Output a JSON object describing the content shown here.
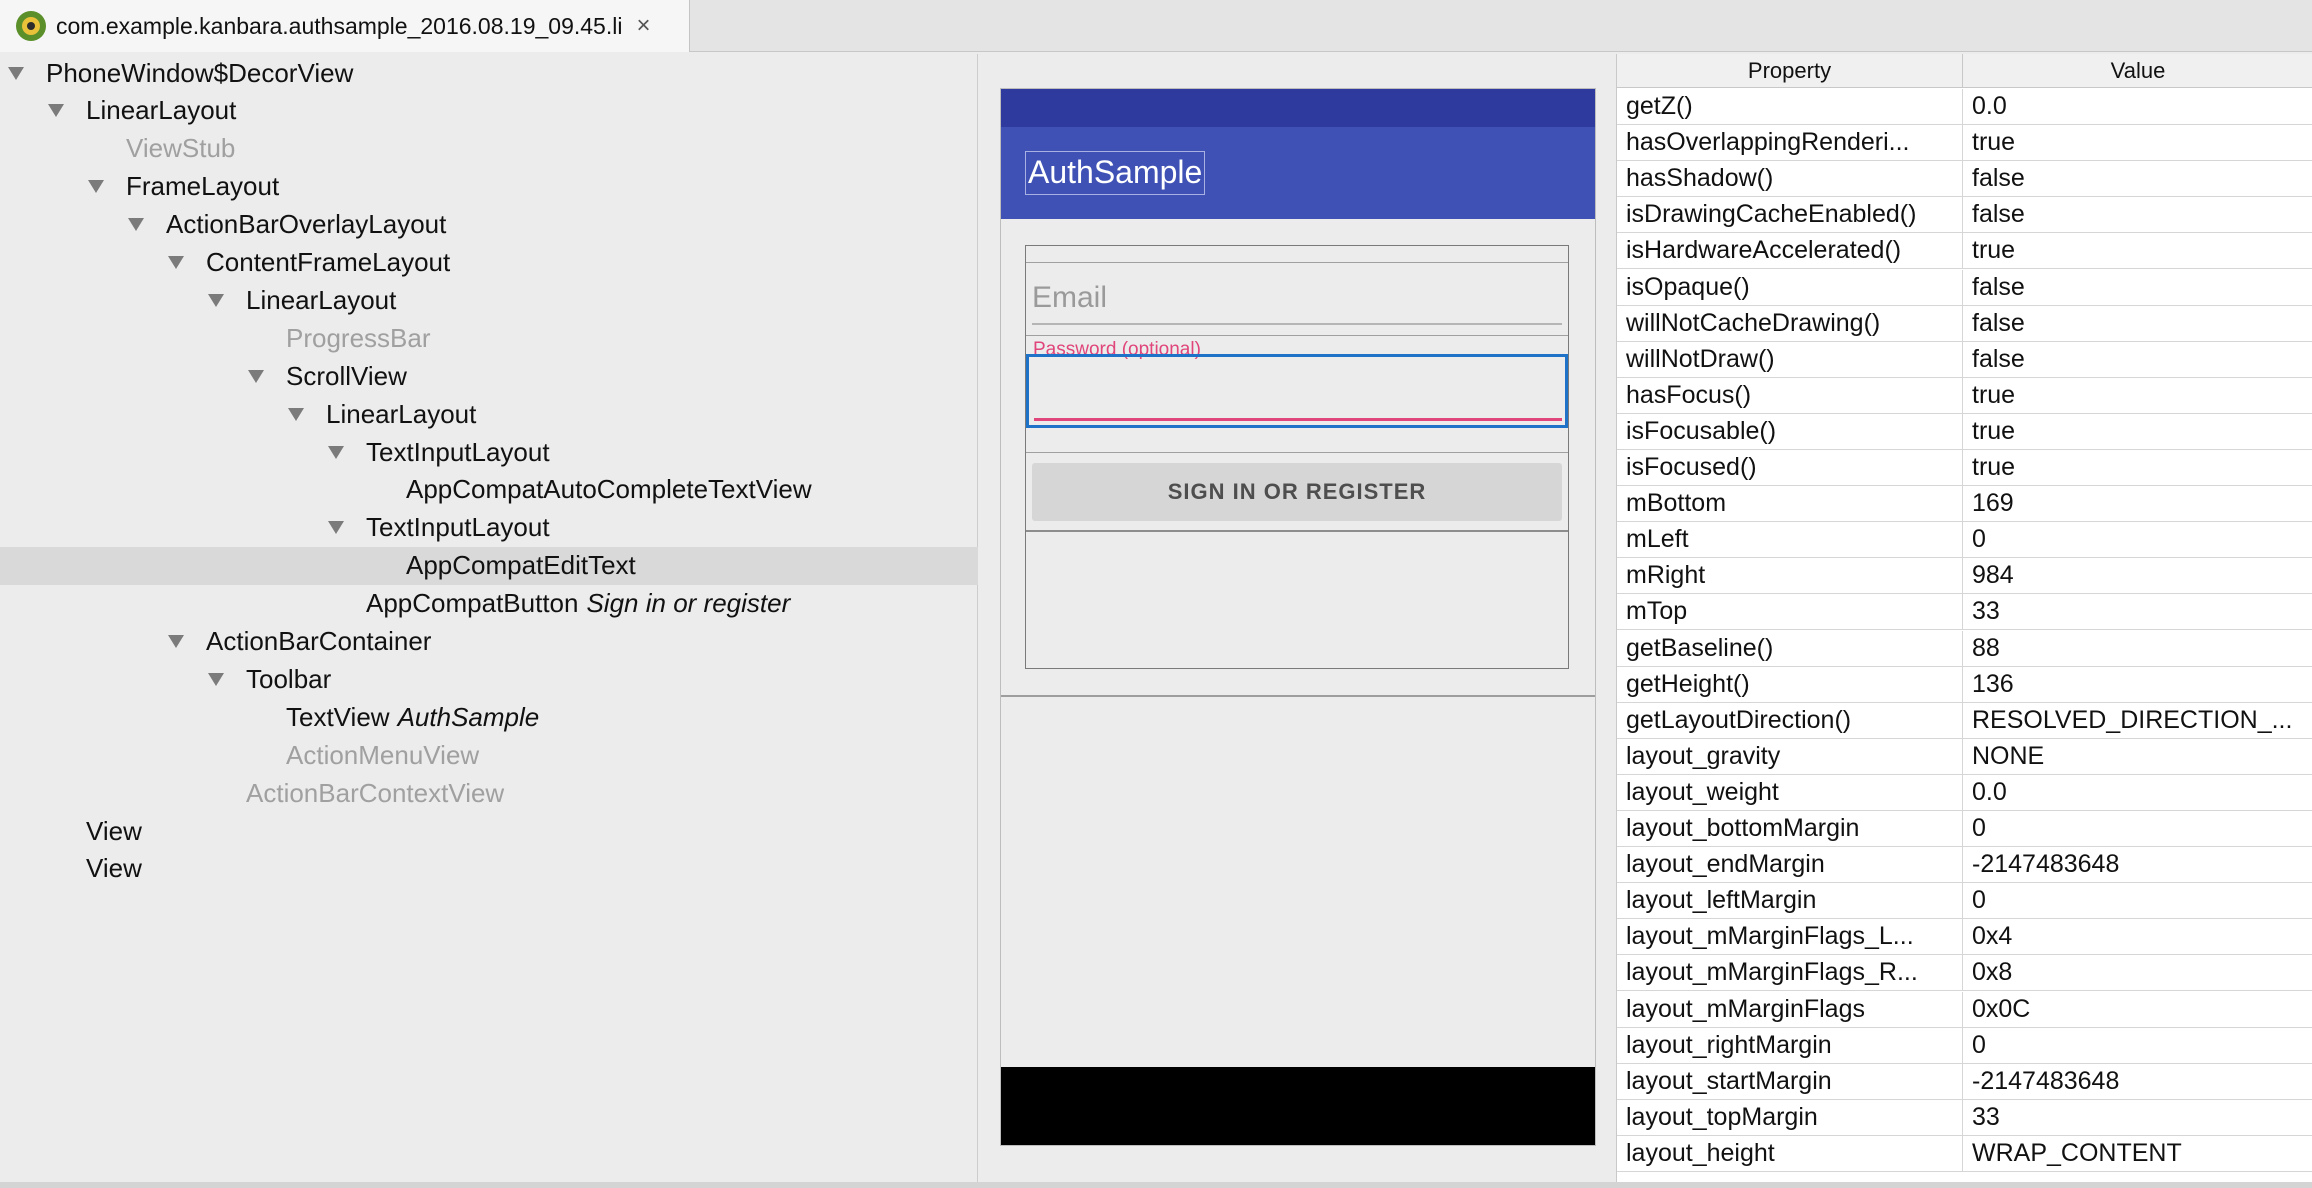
{
  "tab": {
    "title": "com.example.kanbara.authsample_2016.08.19_09.45.li",
    "close_glyph": "×",
    "icon": "android-monitor-icon"
  },
  "tree": [
    {
      "name": "PhoneWindow$DecorView",
      "level": 0,
      "arrow": true,
      "dim": false,
      "sub": ""
    },
    {
      "name": "LinearLayout",
      "level": 1,
      "arrow": true,
      "dim": false,
      "sub": ""
    },
    {
      "name": "ViewStub",
      "level": 2,
      "arrow": false,
      "dim": true,
      "sub": ""
    },
    {
      "name": "FrameLayout",
      "level": 2,
      "arrow": true,
      "dim": false,
      "sub": ""
    },
    {
      "name": "ActionBarOverlayLayout",
      "level": 3,
      "arrow": true,
      "dim": false,
      "sub": ""
    },
    {
      "name": "ContentFrameLayout",
      "level": 4,
      "arrow": true,
      "dim": false,
      "sub": ""
    },
    {
      "name": "LinearLayout",
      "level": 5,
      "arrow": true,
      "dim": false,
      "sub": ""
    },
    {
      "name": "ProgressBar",
      "level": 6,
      "arrow": false,
      "dim": true,
      "sub": ""
    },
    {
      "name": "ScrollView",
      "level": 6,
      "arrow": true,
      "dim": false,
      "sub": ""
    },
    {
      "name": "LinearLayout",
      "level": 7,
      "arrow": true,
      "dim": false,
      "sub": ""
    },
    {
      "name": "TextInputLayout",
      "level": 8,
      "arrow": true,
      "dim": false,
      "sub": ""
    },
    {
      "name": "AppCompatAutoCompleteTextView",
      "level": 9,
      "arrow": false,
      "dim": false,
      "sub": ""
    },
    {
      "name": "TextInputLayout",
      "level": 8,
      "arrow": true,
      "dim": false,
      "sub": ""
    },
    {
      "name": "AppCompatEditText",
      "level": 9,
      "arrow": false,
      "dim": false,
      "sub": "",
      "selected": true
    },
    {
      "name": "AppCompatButton",
      "level": 8,
      "arrow": false,
      "dim": false,
      "sub": "Sign in or register"
    },
    {
      "name": "ActionBarContainer",
      "level": 4,
      "arrow": true,
      "dim": false,
      "sub": ""
    },
    {
      "name": "Toolbar",
      "level": 5,
      "arrow": true,
      "dim": false,
      "sub": ""
    },
    {
      "name": "TextView",
      "level": 6,
      "arrow": false,
      "dim": false,
      "sub": "AuthSample"
    },
    {
      "name": "ActionMenuView",
      "level": 6,
      "arrow": false,
      "dim": true,
      "sub": ""
    },
    {
      "name": "ActionBarContextView",
      "level": 5,
      "arrow": false,
      "dim": true,
      "sub": ""
    },
    {
      "name": "View",
      "level": 1,
      "arrow": false,
      "dim": false,
      "sub": ""
    },
    {
      "name": "View",
      "level": 1,
      "arrow": false,
      "dim": false,
      "sub": ""
    }
  ],
  "preview": {
    "app_title": "AuthSample",
    "email_placeholder": "Email",
    "password_label": "Password (optional)",
    "button_label": "SIGN IN OR REGISTER",
    "colors": {
      "status_bar": "#2f3a9e",
      "toolbar": "#3f51b5",
      "accent": "#e0457b",
      "focus_border": "#1e73c8"
    }
  },
  "props": {
    "header_property": "Property",
    "header_value": "Value",
    "rows": [
      {
        "name": "getZ()",
        "value": "0.0"
      },
      {
        "name": "hasOverlappingRenderi...",
        "value": "true"
      },
      {
        "name": "hasShadow()",
        "value": "false"
      },
      {
        "name": "isDrawingCacheEnabled()",
        "value": "false"
      },
      {
        "name": "isHardwareAccelerated()",
        "value": "true"
      },
      {
        "name": "isOpaque()",
        "value": "false"
      },
      {
        "name": "willNotCacheDrawing()",
        "value": "false"
      },
      {
        "name": "willNotDraw()",
        "value": "false"
      },
      {
        "name": "hasFocus()",
        "value": "true"
      },
      {
        "name": "isFocusable()",
        "value": "true"
      },
      {
        "name": "isFocused()",
        "value": "true"
      },
      {
        "name": "mBottom",
        "value": "169"
      },
      {
        "name": "mLeft",
        "value": "0"
      },
      {
        "name": "mRight",
        "value": "984"
      },
      {
        "name": "mTop",
        "value": "33"
      },
      {
        "name": "getBaseline()",
        "value": "88"
      },
      {
        "name": "getHeight()",
        "value": "136"
      },
      {
        "name": "getLayoutDirection()",
        "value": "RESOLVED_DIRECTION_..."
      },
      {
        "name": "layout_gravity",
        "value": "NONE"
      },
      {
        "name": "layout_weight",
        "value": "0.0"
      },
      {
        "name": "layout_bottomMargin",
        "value": "0"
      },
      {
        "name": "layout_endMargin",
        "value": "-2147483648"
      },
      {
        "name": "layout_leftMargin",
        "value": "0"
      },
      {
        "name": "layout_mMarginFlags_L...",
        "value": "0x4"
      },
      {
        "name": "layout_mMarginFlags_R...",
        "value": "0x8"
      },
      {
        "name": "layout_mMarginFlags",
        "value": "0x0C"
      },
      {
        "name": "layout_rightMargin",
        "value": "0"
      },
      {
        "name": "layout_startMargin",
        "value": "-2147483648"
      },
      {
        "name": "layout_topMargin",
        "value": "33"
      },
      {
        "name": "layout_height",
        "value": "WRAP_CONTENT"
      }
    ]
  }
}
